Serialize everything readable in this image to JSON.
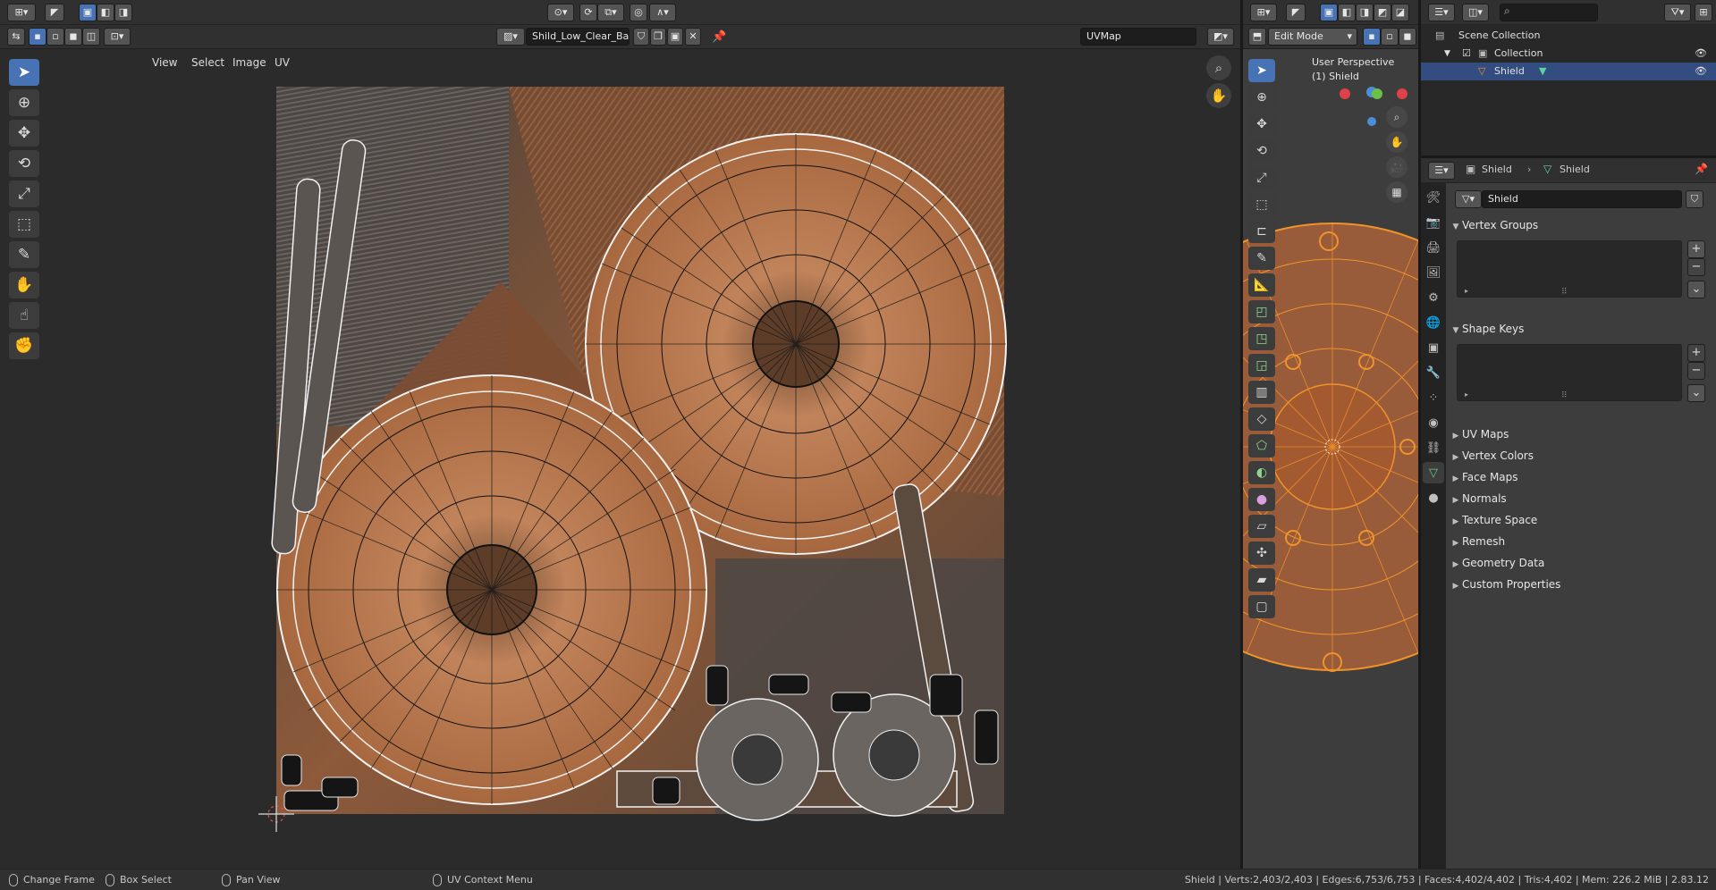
{
  "uv_editor": {
    "menus": [
      "View",
      "Select",
      "Image",
      "UV"
    ],
    "image_name": "Shild_Low_Clear_Ba...",
    "uv_map": "UVMap"
  },
  "viewport": {
    "mode": "Edit Mode",
    "perspective_label": "User Perspective",
    "object_label": "(1) Shield"
  },
  "outliner": {
    "scene_collection": "Scene Collection",
    "collection": "Collection",
    "object": "Shield"
  },
  "properties": {
    "breadcrumb_object": "Shield",
    "breadcrumb_mesh": "Shield",
    "mesh_name": "Shield",
    "panels": {
      "vertex_groups": "Vertex Groups",
      "shape_keys": "Shape Keys",
      "collapsed": [
        "UV Maps",
        "Vertex Colors",
        "Face Maps",
        "Normals",
        "Texture Space",
        "Remesh",
        "Geometry Data",
        "Custom Properties"
      ]
    }
  },
  "statusbar": {
    "change_frame": "Change Frame",
    "box_select": "Box Select",
    "pan_view": "Pan View",
    "uv_context_menu": "UV Context Menu",
    "stats": "Shield | Verts:2,403/2,403 | Edges:6,753/6,753 | Faces:4,402/4,402 | Tris:4,402 | Mem: 226.2 MiB | 2.83.12"
  },
  "colors": {
    "accent": "#4772b3",
    "wood": "#b0714a",
    "edit_orange": "#e38422"
  }
}
